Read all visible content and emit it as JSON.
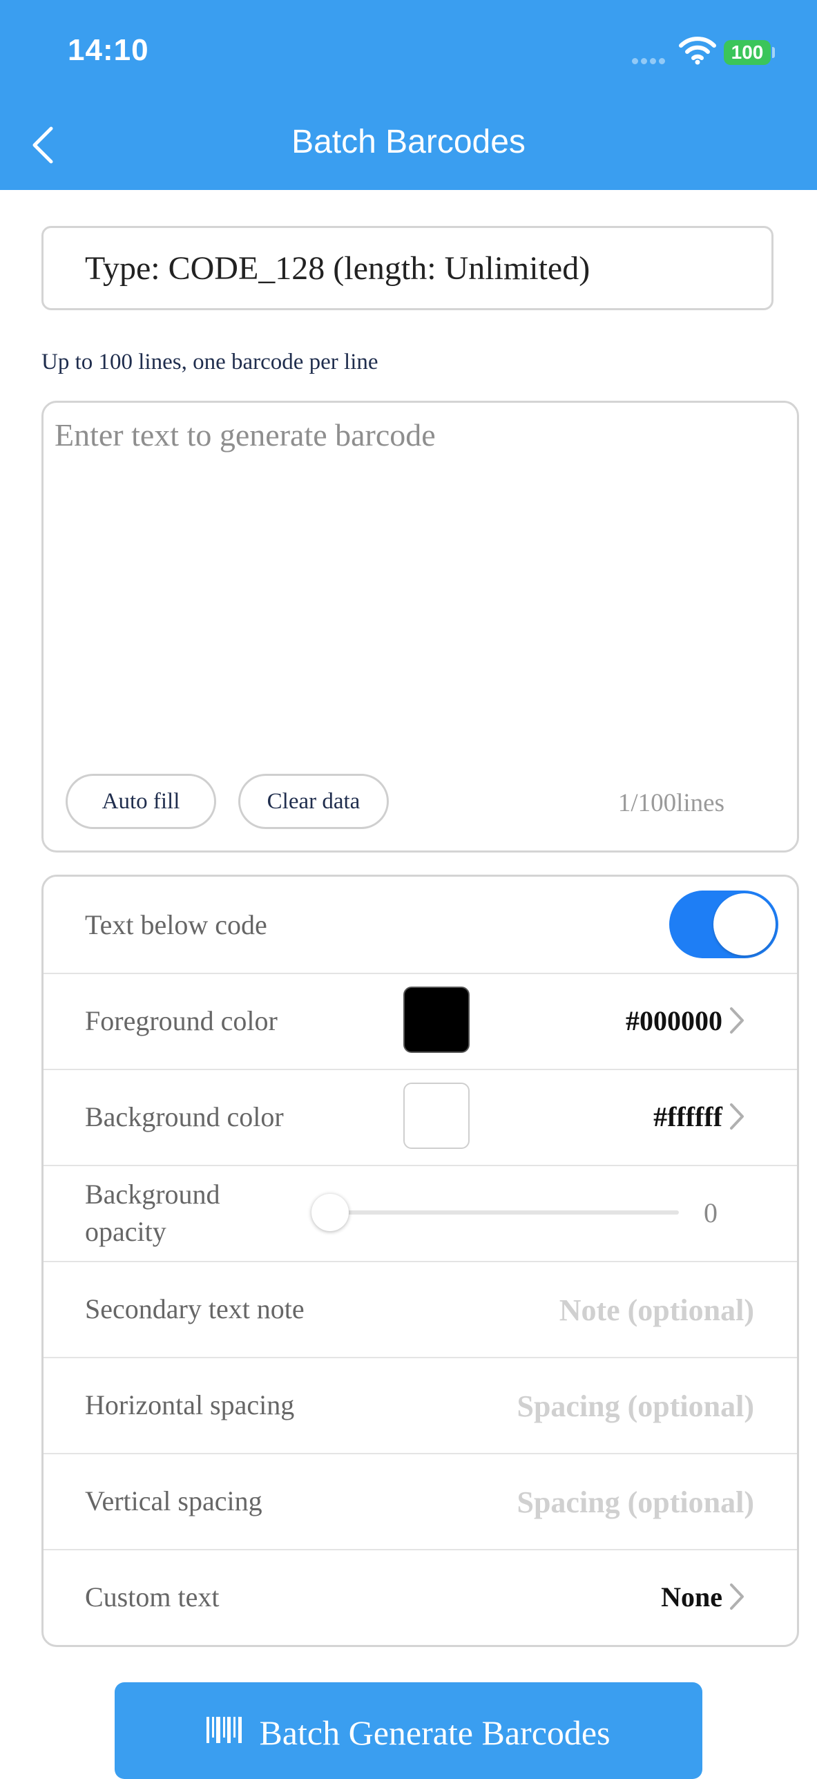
{
  "status_bar": {
    "time": "14:10",
    "battery": "100"
  },
  "nav": {
    "title": "Batch Barcodes"
  },
  "type_box": {
    "text": "Type: CODE_128 (length: Unlimited)"
  },
  "hint": "Up to 100 lines, one barcode per line",
  "text_area": {
    "placeholder": "Enter text to generate barcode",
    "value": "",
    "auto_fill_label": "Auto fill",
    "clear_data_label": "Clear data",
    "line_count": "1/100lines"
  },
  "settings": {
    "text_below_code": {
      "label": "Text below code",
      "enabled": true
    },
    "foreground": {
      "label": "Foreground color",
      "value": "#000000",
      "color": "#000000"
    },
    "background": {
      "label": "Background color",
      "value": "#ffffff",
      "color": "#ffffff"
    },
    "opacity": {
      "label": "Background opacity",
      "value": "0"
    },
    "secondary_note": {
      "label": "Secondary text note",
      "placeholder": "Note (optional)"
    },
    "horizontal_spacing": {
      "label": "Horizontal spacing",
      "placeholder": "Spacing (optional)"
    },
    "vertical_spacing": {
      "label": "Vertical spacing",
      "placeholder": "Spacing (optional)"
    },
    "custom_text": {
      "label": "Custom text",
      "value": "None"
    }
  },
  "generate_button": {
    "label": "Batch Generate Barcodes"
  },
  "colors": {
    "accent": "#3a9ef0",
    "toggle_on": "#1e7ef5"
  }
}
